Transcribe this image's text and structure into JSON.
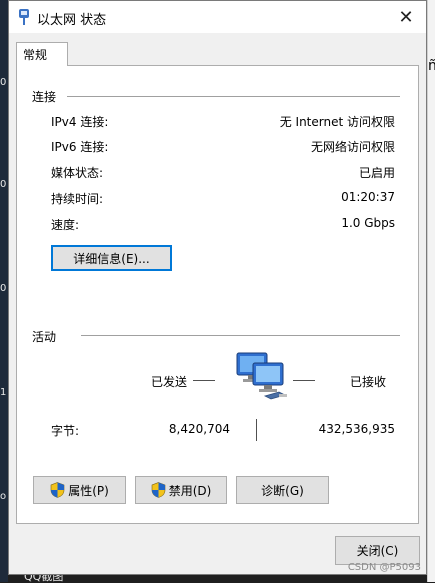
{
  "window": {
    "title": "以太网 状态"
  },
  "tabs": [
    {
      "label": "常规"
    }
  ],
  "connection": {
    "section_label": "连接",
    "rows": [
      {
        "label": "IPv4 连接:",
        "value": "无 Internet 访问权限"
      },
      {
        "label": "IPv6 连接:",
        "value": "无网络访问权限"
      },
      {
        "label": "媒体状态:",
        "value": "已启用"
      },
      {
        "label": "持续时间:",
        "value": "01:20:37"
      },
      {
        "label": "速度:",
        "value": "1.0 Gbps"
      }
    ],
    "details_button": "详细信息(E)..."
  },
  "activity": {
    "section_label": "活动",
    "sent_label": "已发送",
    "received_label": "已接收",
    "bytes_label": "字节:",
    "bytes_sent": "8,420,704",
    "bytes_received": "432,536,935"
  },
  "buttons": {
    "properties": "属性(P)",
    "disable": "禁用(D)",
    "diagnose": "诊断(G)",
    "close": "关闭(C)"
  },
  "background": {
    "left_fragments": [
      "0",
      "0",
      "0",
      "1",
      "o"
    ],
    "right_fragment": "ñ",
    "bottom_left_text": "QQ截图",
    "watermark": "CSDN @P5093"
  },
  "icons": [
    "network-adapter-icon",
    "close-icon",
    "shield-icon",
    "network-computers-icon"
  ]
}
